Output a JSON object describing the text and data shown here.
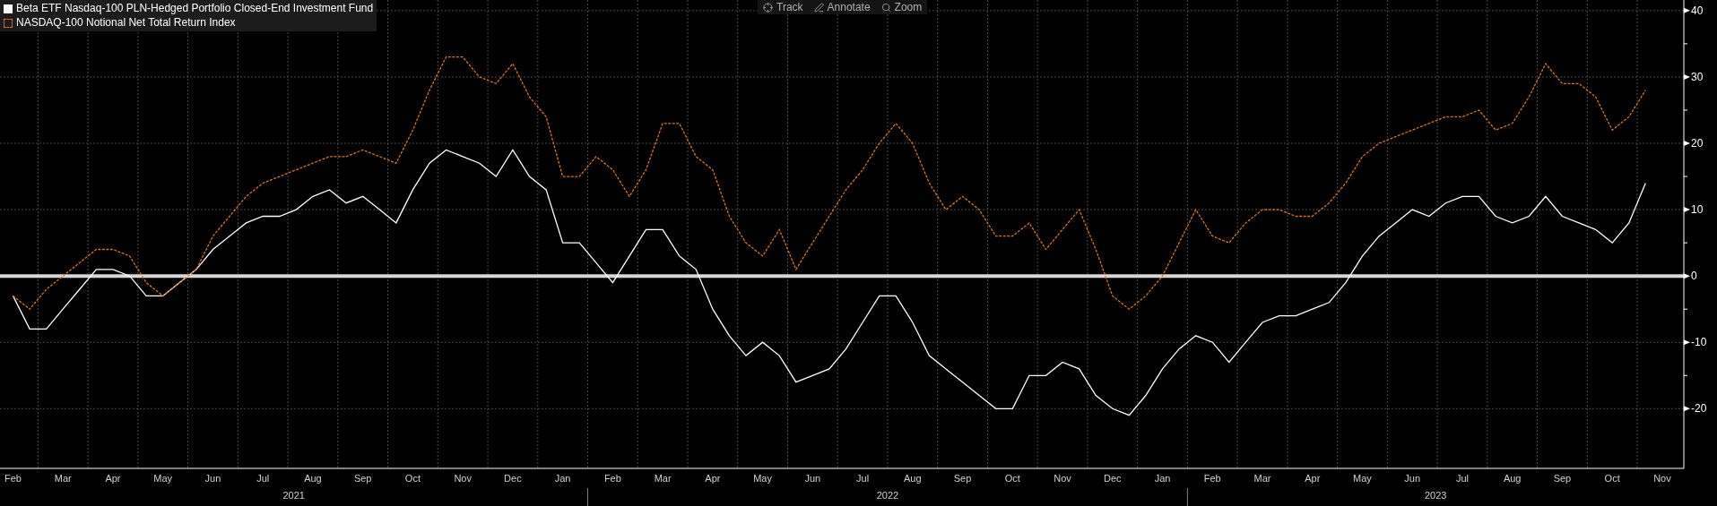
{
  "toolbar": [
    {
      "label": "Track",
      "kind": "track"
    },
    {
      "label": "Annotate",
      "kind": "annotate"
    },
    {
      "label": "Zoom",
      "kind": "zoom"
    }
  ],
  "chart": {
    "chart_data": {
      "type": "line",
      "categories": [
        "Feb",
        null,
        null,
        "Mar",
        null,
        null,
        "Apr",
        null,
        null,
        "May",
        null,
        null,
        "Jun",
        null,
        null,
        "Jul",
        null,
        null,
        "Aug",
        null,
        null,
        "Sep",
        null,
        null,
        "Oct",
        null,
        null,
        "Nov",
        null,
        null,
        "Dec",
        null,
        null,
        "Jan",
        null,
        null,
        "Feb",
        null,
        null,
        "Mar",
        null,
        null,
        "Apr",
        null,
        null,
        "May",
        null,
        null,
        "Jun",
        null,
        null,
        "Jul",
        null,
        null,
        "Aug",
        null,
        null,
        "Sep",
        null,
        null,
        "Oct",
        null,
        null,
        "Nov",
        null,
        null,
        "Dec",
        null,
        null,
        "Jan",
        null,
        null,
        "Feb",
        null,
        null,
        "Mar",
        null,
        null,
        "Apr",
        null,
        null,
        "May",
        null,
        null,
        "Jun",
        null,
        null,
        "Jul",
        null,
        null,
        "Aug",
        null,
        null,
        "Sep",
        null,
        null,
        "Oct",
        null,
        null,
        "Nov"
      ],
      "series": [
        {
          "name": "Beta ETF Nasdaq-100 PLN-Hedged Portfolio Closed-End Investment Fund",
          "color": "#ffffff",
          "line_style": "solid",
          "values": [
            -3,
            -8,
            -8,
            -5,
            -2,
            1,
            1,
            0,
            -3,
            -3,
            -1,
            1,
            4,
            6,
            8,
            9,
            9,
            10,
            12,
            13,
            11,
            12,
            10,
            8,
            13,
            17,
            19,
            18,
            17,
            15,
            19,
            15,
            13,
            5,
            5,
            2,
            -1,
            3,
            7,
            7,
            3,
            1,
            -5,
            -9,
            -12,
            -10,
            -12,
            -16,
            -15,
            -14,
            -11,
            -7,
            -3,
            -3,
            -7,
            -12,
            -14,
            -16,
            -18,
            -20,
            -20,
            -15,
            -15,
            -13,
            -14,
            -18,
            -20,
            -21,
            -18,
            -14,
            -11,
            -9,
            -10,
            -13,
            -10,
            -7,
            -6,
            -6,
            -5,
            -4,
            -1,
            3,
            6,
            8,
            10,
            9,
            11,
            12,
            12,
            9,
            8,
            9,
            12,
            9,
            8,
            7,
            5,
            8,
            14,
            null
          ]
        },
        {
          "name": "NASDAQ-100 Notional Net Total Return Index",
          "color": "#e0701a",
          "line_style": "dashed",
          "values": [
            -3,
            -5,
            -2,
            0,
            2,
            4,
            4,
            3,
            -1,
            -3,
            -1,
            1,
            6,
            9,
            12,
            14,
            15,
            16,
            17,
            18,
            18,
            19,
            18,
            17,
            22,
            28,
            33,
            33,
            30,
            29,
            32,
            27,
            24,
            15,
            15,
            18,
            16,
            12,
            16,
            23,
            23,
            18,
            16,
            9,
            5,
            3,
            7,
            1,
            5,
            9,
            13,
            16,
            20,
            23,
            20,
            14,
            10,
            12,
            10,
            6,
            6,
            8,
            4,
            7,
            10,
            4,
            -3,
            -5,
            -3,
            0,
            5,
            10,
            6,
            5,
            8,
            10,
            10,
            9,
            9,
            11,
            14,
            18,
            20,
            21,
            22,
            23,
            24,
            24,
            25,
            22,
            23,
            27,
            32,
            29,
            29,
            27,
            22,
            24,
            28,
            null
          ]
        }
      ],
      "ylim": [
        -29,
        41.6
      ],
      "yticks": [
        -20,
        -10,
        0,
        10,
        20,
        30,
        40
      ],
      "grid": true
    },
    "year_labels": [
      "2021",
      "2022",
      "2023"
    ]
  }
}
